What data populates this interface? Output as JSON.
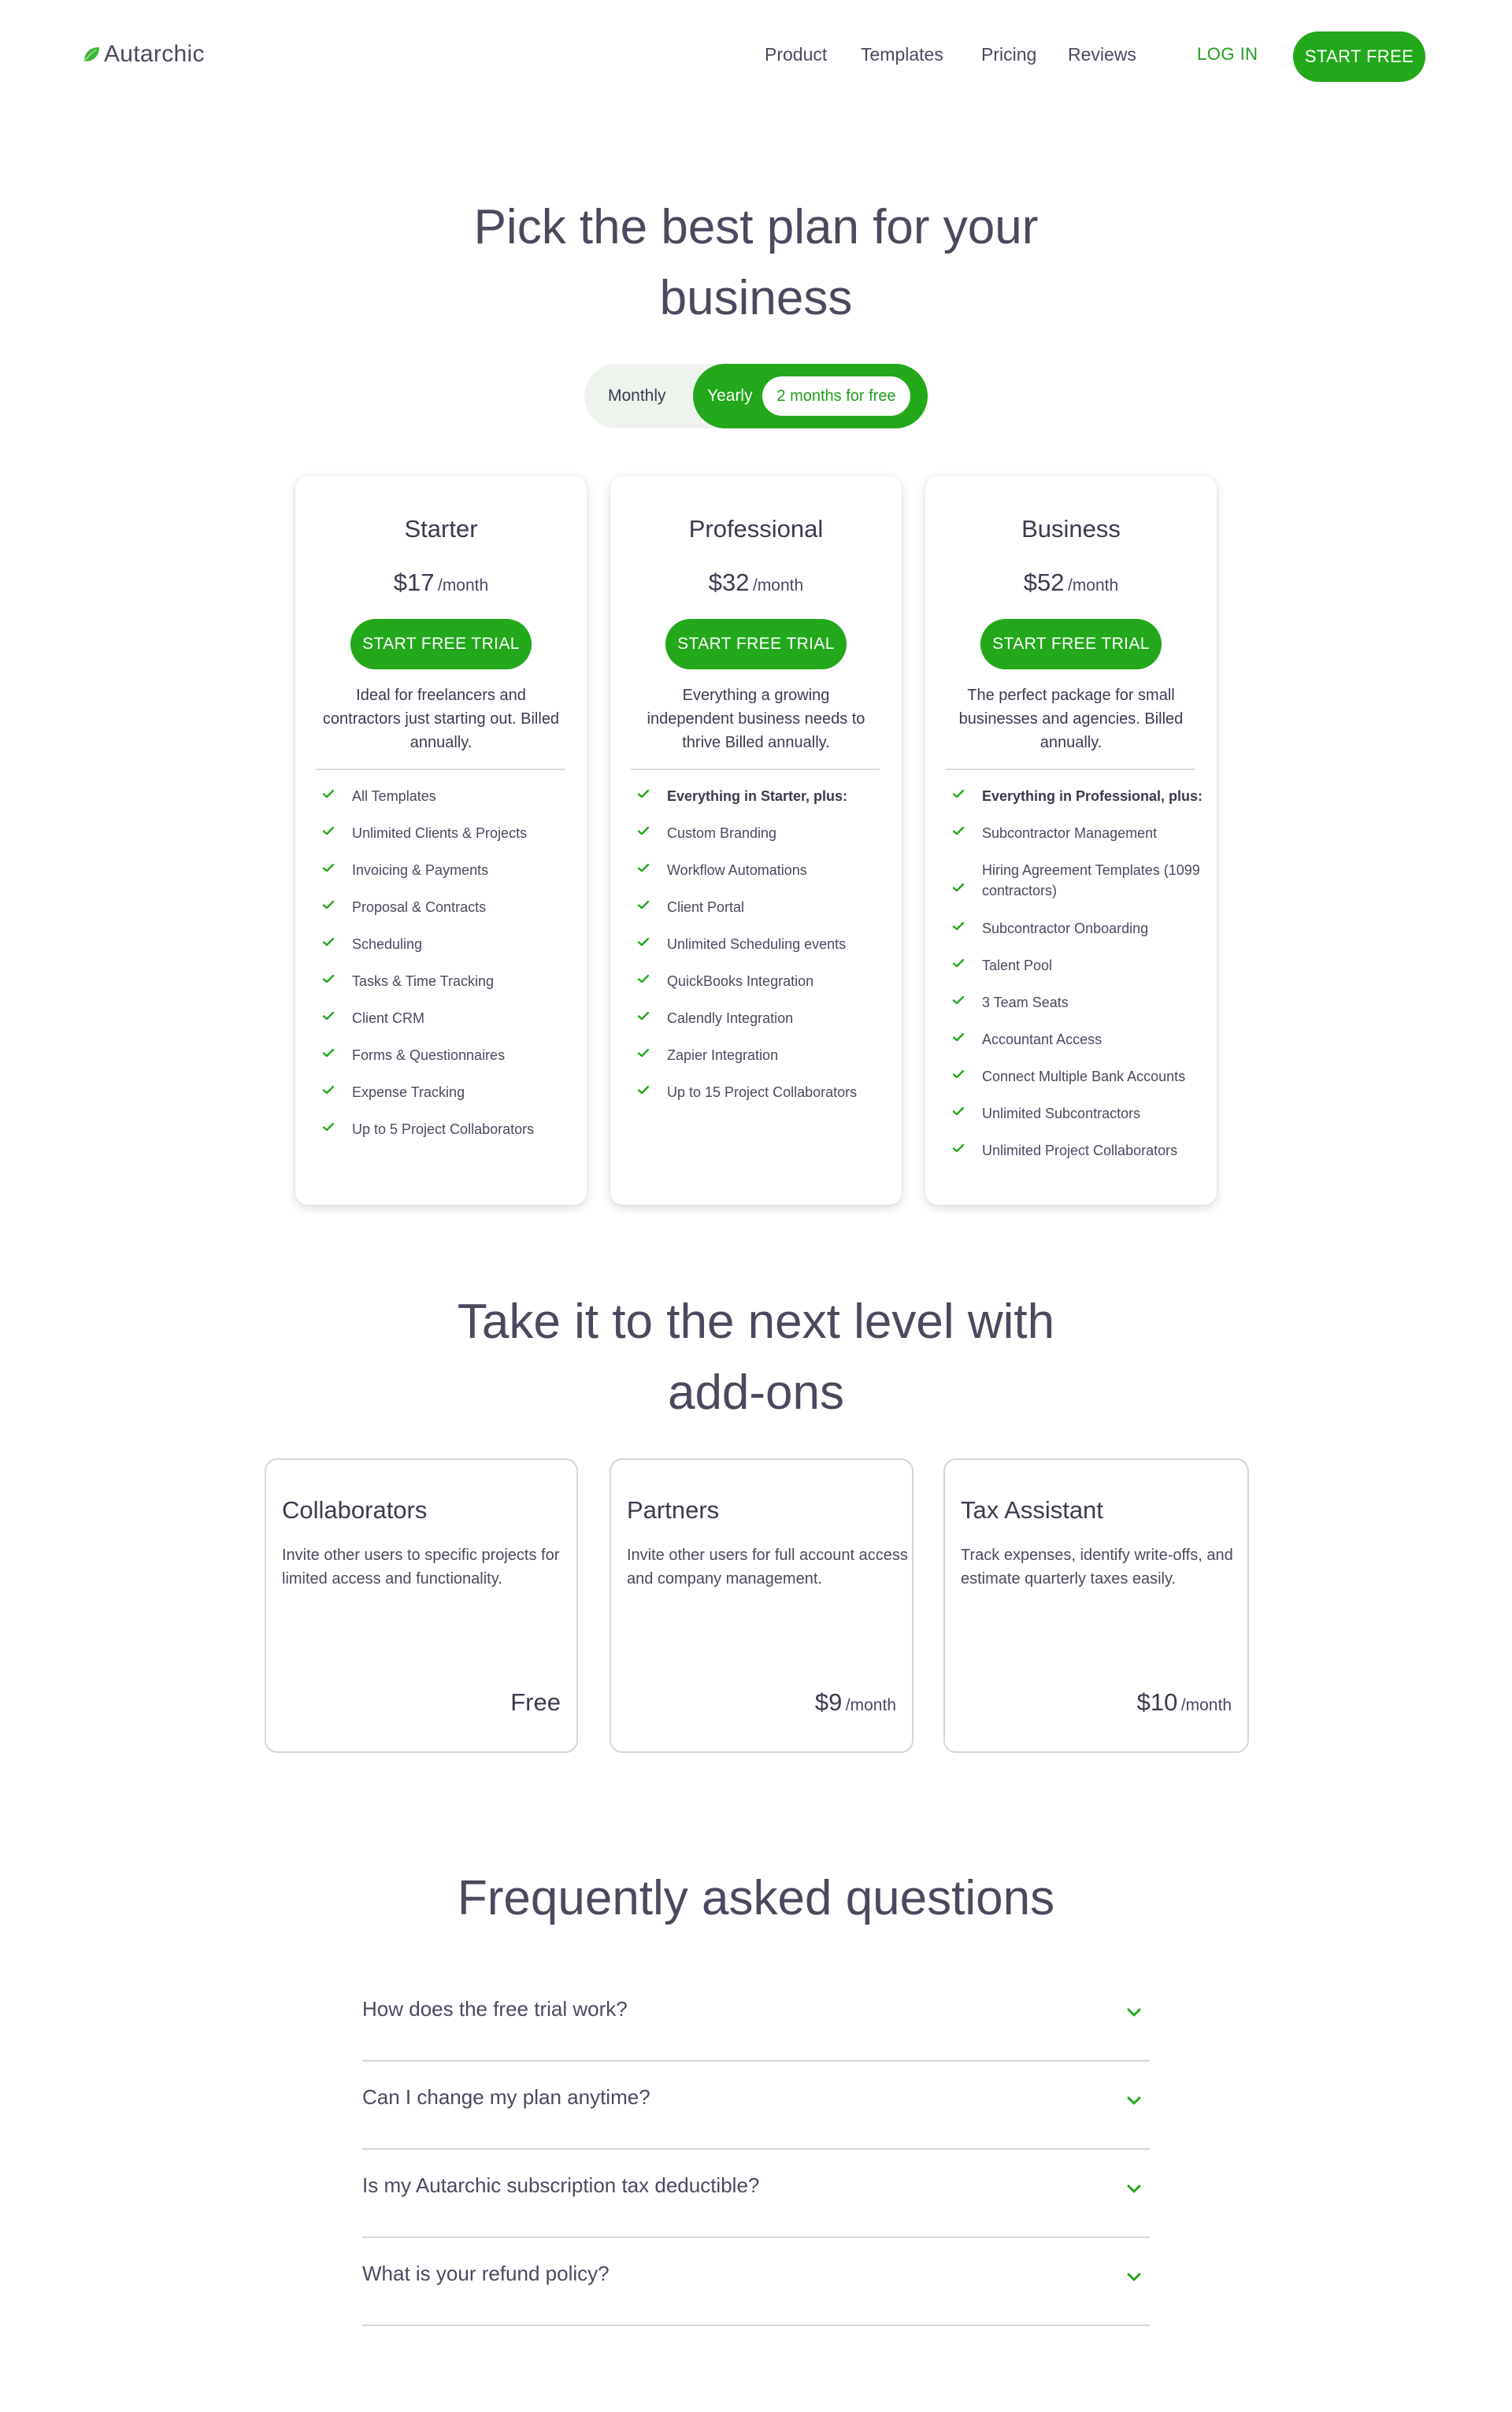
{
  "header": {
    "logo_text": "Autarchic",
    "nav": [
      "Product",
      "Templates",
      "Pricing",
      "Reviews"
    ],
    "login": "LOG IN",
    "start": "START FREE"
  },
  "hero": {
    "title_line1": "Pick the best plan for your",
    "title_line2": "business",
    "toggle_monthly": "Monthly",
    "toggle_yearly": "Yearly",
    "toggle_badge": "2 months for free"
  },
  "plans": [
    {
      "name": "Starter",
      "price": "$17",
      "per": "/month",
      "cta": "START FREE TRIAL",
      "desc": "Ideal for freelancers and contractors just starting out. Billed annually.",
      "features": [
        "All Templates",
        "Unlimited Clients & Projects",
        "Invoicing & Payments",
        "Proposal & Contracts",
        "Scheduling",
        "Tasks & Time Tracking",
        "Client CRM",
        "Forms & Questionnaires",
        "Expense Tracking",
        "Up to 5 Project Collaborators"
      ]
    },
    {
      "name": "Professional",
      "price": "$32",
      "per": "/month",
      "cta": "START FREE TRIAL",
      "desc": "Everything a growing independent business needs to thrive Billed annually.",
      "features": [
        "Everything in Starter, plus:",
        "Custom Branding",
        "Workflow Automations",
        "Client Portal",
        "Unlimited Scheduling events",
        "QuickBooks Integration",
        "Calendly Integration",
        "Zapier Integration",
        "Up to 15 Project Collaborators"
      ]
    },
    {
      "name": "Business",
      "price": "$52",
      "per": "/month",
      "cta": "START FREE TRIAL",
      "desc": "The perfect package for small businesses and agencies. Billed annually.",
      "features": [
        "Everything in Professional, plus:",
        "Subcontractor Management",
        "Hiring Agreement Templates (1099 contractors)",
        "Subcontractor Onboarding",
        "Talent Pool",
        "3 Team Seats",
        "Accountant Access",
        "Connect Multiple Bank Accounts",
        "Unlimited Subcontractors",
        "Unlimited Project Collaborators"
      ]
    }
  ],
  "addons": {
    "title_line1": "Take it to the next level with",
    "title_line2": "add-ons",
    "items": [
      {
        "name": "Collaborators",
        "desc": "Invite other users to specific projects for limited access and functionality.",
        "price": "Free",
        "per": ""
      },
      {
        "name": "Partners",
        "desc": "Invite other users for full account access and company management.",
        "price": "$9",
        "per": "/month"
      },
      {
        "name": "Tax Assistant",
        "desc": "Track expenses, identify write-offs, and estimate quarterly taxes easily.",
        "price": "$10",
        "per": "/month"
      }
    ]
  },
  "faq": {
    "title": "Frequently asked questions",
    "items": [
      "How does the free trial work?",
      "Can I change my plan anytime?",
      "Is my Autarchic subscription tax deductible?",
      "What is your refund policy?"
    ]
  },
  "colors": {
    "accent": "#22a81a",
    "text": "#4a4a5e"
  },
  "icons": {
    "logo": "leaf-icon",
    "check": "check-icon",
    "chevron": "chevron-down-icon"
  }
}
